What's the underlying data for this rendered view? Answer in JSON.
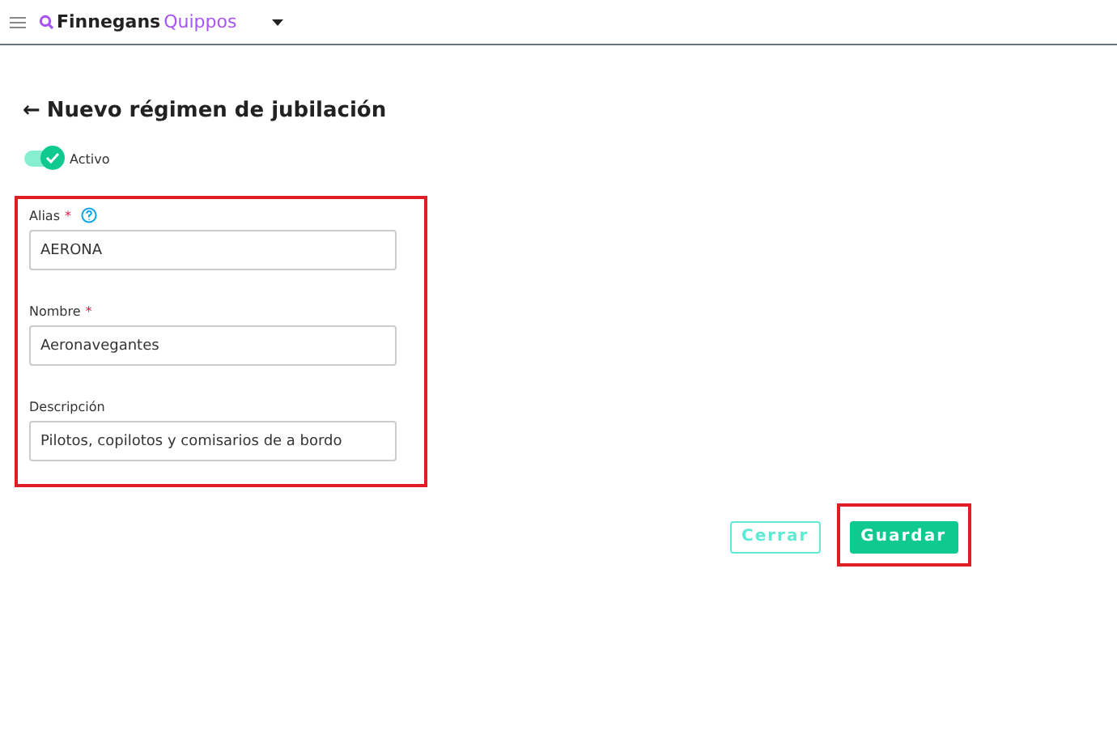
{
  "header": {
    "brand": {
      "part1": "Finnegans",
      "part2": "Quippos"
    }
  },
  "page": {
    "title": "Nuevo régimen de jubilación",
    "back_arrow": "←"
  },
  "toggle": {
    "label": "Activo",
    "on": true
  },
  "form": {
    "highlighted": true,
    "fields": [
      {
        "label": "Alias",
        "required_mark": "*",
        "help": true,
        "value": "AERONA"
      },
      {
        "label": "Nombre",
        "required_mark": "*",
        "value": "Aeronavegantes"
      },
      {
        "label": "Descripción",
        "value": "Pilotos, copilotos y comisarios de a bordo"
      }
    ]
  },
  "buttons": [
    {
      "label": "Cerrar",
      "kind": "outline",
      "highlighted": false
    },
    {
      "label": "Guardar",
      "kind": "primary",
      "highlighted": true
    }
  ]
}
